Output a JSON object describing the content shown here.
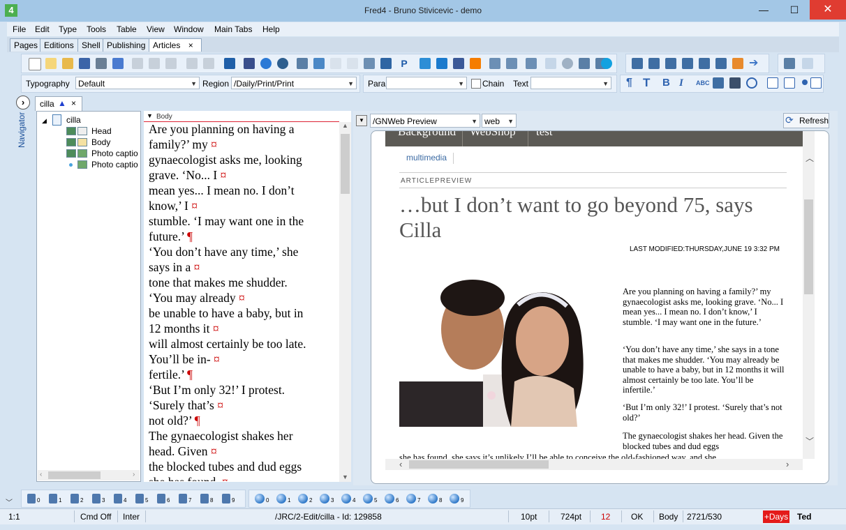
{
  "window": {
    "title": "Fred4 - Bruno Stivicevic - demo",
    "app_icon": "4",
    "min_glyph": "—",
    "max_glyph": "☐",
    "close_glyph": "✕"
  },
  "menu": [
    "File",
    "Edit",
    "Type",
    "Tools",
    "Table",
    "View",
    "Window",
    "Main Tabs",
    "Help"
  ],
  "tabs": {
    "items": [
      "Pages",
      "Editions",
      "Shell",
      "Publishing",
      "Articles"
    ],
    "close_glyph": "×"
  },
  "typography_bar": {
    "typography_label": "Typography",
    "typography_value": "Default",
    "region_label": "Region",
    "region_value": "/Daily/Print/Print",
    "para_label": "Para",
    "para_value": "",
    "chain_label": "Chain",
    "text_label": "Text",
    "text_value": ""
  },
  "doc_tab": {
    "label": "cilla",
    "close_glyph": "×",
    "warn_glyph": "▲",
    "nav_glyph": "›"
  },
  "navigator": {
    "label": "Navigator",
    "root": "cilla",
    "items": [
      "Head",
      "Body",
      "Photo captio",
      "Photo captio"
    ]
  },
  "editor": {
    "header": "Body",
    "lines": [
      {
        "text": "Are you planning on having a",
        "mark": ""
      },
      {
        "text": "family?’ my",
        "mark": "¤"
      },
      {
        "text": "gynaecologist asks me, looking",
        "mark": ""
      },
      {
        "text": "grave. ‘No... I",
        "mark": "¤"
      },
      {
        "text": "mean yes... I mean no. I don’t",
        "mark": ""
      },
      {
        "text": "know,’ I",
        "mark": "¤"
      },
      {
        "text": "stumble. ‘I may want one in the",
        "mark": ""
      },
      {
        "text": "future.’",
        "mark": "¶"
      },
      {
        "text": "‘You don’t have any time,’ she",
        "mark": ""
      },
      {
        "text": "says in a",
        "mark": "¤"
      },
      {
        "text": "tone that makes me shudder.",
        "mark": ""
      },
      {
        "text": "‘You may already",
        "mark": "¤"
      },
      {
        "text": "be unable to have a baby, but in",
        "mark": ""
      },
      {
        "text": "12 months it",
        "mark": "¤"
      },
      {
        "text": "will almost certainly be too late.",
        "mark": ""
      },
      {
        "text": "You’ll be in-",
        "mark": "¤"
      },
      {
        "text": "fertile.’",
        "mark": "¶"
      },
      {
        "text": "‘But I’m only 32!’ I protest.",
        "mark": ""
      },
      {
        "text": "‘Surely that’s",
        "mark": "¤"
      },
      {
        "text": "not old?’",
        "mark": "¶"
      },
      {
        "text": "The gynaecologist shakes her",
        "mark": ""
      },
      {
        "text": "head. Given",
        "mark": "¤"
      },
      {
        "text": "the blocked tubes and dud eggs",
        "mark": ""
      },
      {
        "text": "she has found,",
        "mark": "¤"
      }
    ]
  },
  "preview": {
    "source": "/GNWeb Preview",
    "channel": "web",
    "refresh_label": "Refresh",
    "nav": [
      "Background",
      "WebShop",
      "test"
    ],
    "subnav": "multimedia",
    "section": "ARTICLEPREVIEW",
    "title": "…but I don’t want to go beyond 75, says Cilla",
    "modified": "LAST MODIFIED:THURSDAY,JUNE 19 3:32 PM",
    "paragraphs": [
      "Are you planning on having a family?’ my gynaecologist asks me, looking grave. ‘No... I mean yes... I mean no. I don’t know,’ I stumble. ‘I may want one in the future.’",
      "‘You don’t have any time,’ she says in a tone that makes me shudder. ‘You may already be unable to have a baby, but in 12 months it will almost certainly be too late. You’ll be infertile.’",
      "‘But I’m only 32!’ I protest. ‘Surely that’s not old?’",
      "The gynaecologist shakes her head. Given the blocked tubes and dud eggs"
    ],
    "tail": "she has found, she says it’s unlikely I’ll be able to conceive the old-fashioned way, and she"
  },
  "bookmarks": {
    "set_a": [
      "0",
      "1",
      "2",
      "3",
      "4",
      "5",
      "6",
      "7",
      "8",
      "9"
    ],
    "set_b": [
      "0",
      "1",
      "2",
      "3",
      "4",
      "5",
      "6",
      "7",
      "8",
      "9"
    ]
  },
  "status": {
    "position": "1:1",
    "cmd": "Cmd Off",
    "mode": "Inter",
    "path": "/JRC/2-Edit/cilla - Id: 129858",
    "font_size": "10pt",
    "width": "724pt",
    "count": "12",
    "ok": "OK",
    "para": "Body",
    "chars": "2721/530",
    "days": "+Days",
    "user": "Ted"
  }
}
